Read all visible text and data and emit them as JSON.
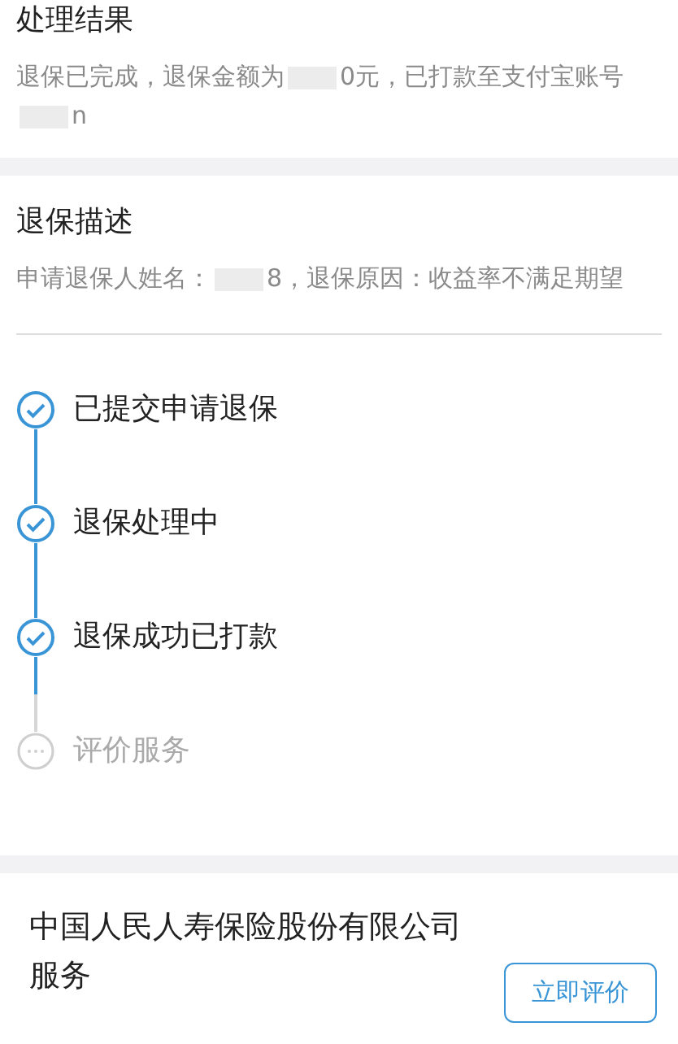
{
  "result_section": {
    "title": "处理结果",
    "description": [
      {
        "kind": "text",
        "text": "退保已完成，退保金额为"
      },
      {
        "kind": "redacted"
      },
      {
        "kind": "text",
        "text": "0元，已打款至支付宝账号"
      },
      {
        "kind": "redacted"
      },
      {
        "kind": "text",
        "text": "n"
      }
    ]
  },
  "description_section": {
    "title": "退保描述",
    "description": [
      {
        "kind": "text",
        "text": "申请退保人姓名："
      },
      {
        "kind": "redacted"
      },
      {
        "kind": "text",
        "text": "8，退保原因：收益率不满足期望"
      }
    ]
  },
  "steps": [
    {
      "label": "已提交申请退保",
      "done": true
    },
    {
      "label": "退保处理中",
      "done": true
    },
    {
      "label": "退保成功已打款",
      "done": true
    },
    {
      "label": "评价服务",
      "done": false
    }
  ],
  "review_card": {
    "text": "中国人民人寿保险股份有限公司服务",
    "button": "立即评价"
  }
}
